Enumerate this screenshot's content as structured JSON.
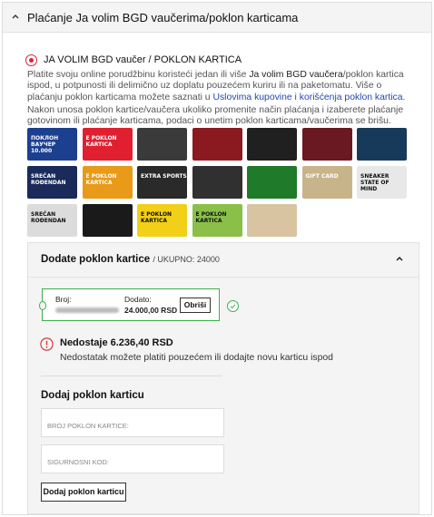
{
  "header": {
    "title": "Plaćanje Ja volim BGD vaučerima/poklon karticama",
    "chevron_icon": "chevron-up-icon"
  },
  "option": {
    "label": "JA VOLIM BGD vaučer / POKLON KARTICA",
    "selected": true,
    "p1_a": "Platite svoju online porudžbinu koristeći jedan ili više ",
    "p1_b": "Ja volim BGD vaučera",
    "p1_c": "/poklon kartica ispod, u potpunosti ili delimično uz doplatu pouzećem kuriru ili na paketomatu. Više o plaćanju poklon karticama možete saznati u ",
    "p1_link": "Uslovima kupovine i korišćenja poklon kartica",
    "p1_end": ".",
    "p2": "Nakon unosa poklon kartice/vaučera ukoliko promenite način plaćanja i izaberete plaćanje gotovinom ili plaćanje karticama, podaci o unetim poklon karticama/vaučerima se brišu."
  },
  "cards": [
    {
      "text": "ПОКЛОН ВАУЧЕР 10.000",
      "bg": "#1d3f8f",
      "fg": "#ffffff"
    },
    {
      "text": "E POKLON KARTICA",
      "bg": "#e02030",
      "fg": "#ffffff"
    },
    {
      "text": "",
      "bg": "#3a3a3a",
      "fg": "#ffffff"
    },
    {
      "text": "",
      "bg": "#8a1a20",
      "fg": "#ffffff"
    },
    {
      "text": "",
      "bg": "#202020",
      "fg": "#f0d020"
    },
    {
      "text": "",
      "bg": "#6a1822",
      "fg": "#ffffff"
    },
    {
      "text": "",
      "bg": "#183a5a",
      "fg": "#ffffff"
    },
    {
      "text": "SREĆAN ROĐENDAN",
      "bg": "#1a2a5a",
      "fg": "#ffffff"
    },
    {
      "text": "E POKLON KARTICA",
      "bg": "#e89a18",
      "fg": "#ffffff"
    },
    {
      "text": "EXTRA SPORTS",
      "bg": "#2a2a2a",
      "fg": "#ffffff"
    },
    {
      "text": "",
      "bg": "#303030",
      "fg": "#f0d020"
    },
    {
      "text": "",
      "bg": "#1f7a2a",
      "fg": "#ffffff"
    },
    {
      "text": "GIFT CARD",
      "bg": "#c8b48a",
      "fg": "#ffffff"
    },
    {
      "text": "SNEAKER STATE OF MIND",
      "bg": "#e8e8e8",
      "fg": "#111111"
    },
    {
      "text": "SREĆAN ROĐENDAN",
      "bg": "#dcdcdc",
      "fg": "#111111"
    },
    {
      "text": "",
      "bg": "#1a1a1a",
      "fg": "#ffffff"
    },
    {
      "text": "E POKLON KARTICA",
      "bg": "#f2d018",
      "fg": "#111111"
    },
    {
      "text": "E POKLON KARTICA",
      "bg": "#8ac048",
      "fg": "#111111"
    },
    {
      "text": "",
      "bg": "#d8c4a0",
      "fg": "#111111"
    }
  ],
  "added": {
    "title": "Dodate poklon kartice",
    "total": "/ UKUPNO: 24000",
    "number_label": "Broj:",
    "added_label": "Dodato:",
    "added_value": "24.000,00 RSD",
    "remove_label": "Obriši",
    "chevron_icon": "chevron-up-icon",
    "check_icon": "check-circle-icon"
  },
  "missing": {
    "label": "Nedostaje 6.236,40 RSD",
    "description": "Nedostatak možete platiti pouzećem ili dodajte novu karticu ispod",
    "icon": "alert-circle-icon",
    "color": "#d23a3a"
  },
  "form": {
    "title": "Dodaj poklon karticu",
    "card_number_placeholder": "BROJ POKLON KARTICE:",
    "security_code_placeholder": "SIGURNOSNI KOD:",
    "submit_label": "Dodaj poklon karticu"
  }
}
